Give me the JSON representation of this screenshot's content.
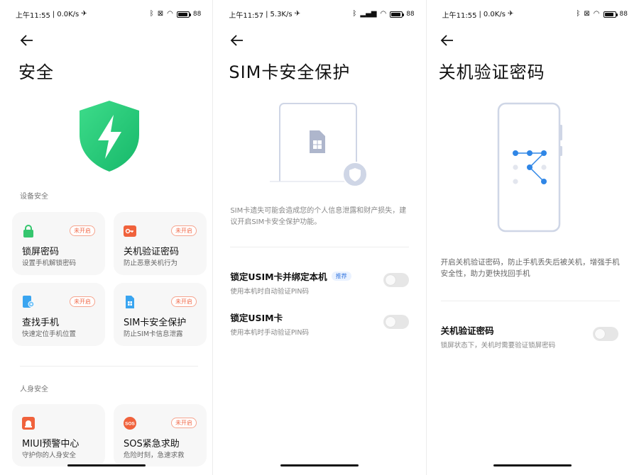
{
  "screens": [
    {
      "status": {
        "time": "上午11:55",
        "speed": "0.0K/s",
        "battery": "88"
      },
      "title": "安全",
      "sections": [
        {
          "label": "设备安全"
        },
        {
          "label": "人身安全"
        }
      ],
      "cards": [
        {
          "title": "锁屏密码",
          "subtitle": "设置手机解锁密码",
          "badge": "未开启",
          "icon": "lock-icon"
        },
        {
          "title": "关机验证密码",
          "subtitle": "防止恶意关机行为",
          "badge": "未开启",
          "icon": "key-icon"
        },
        {
          "title": "查找手机",
          "subtitle": "快速定位手机位置",
          "badge": "未开启",
          "icon": "find-phone-icon"
        },
        {
          "title": "SIM卡安全保护",
          "subtitle": "防止SIM卡信息泄露",
          "badge": "未开启",
          "icon": "sim-card-icon"
        },
        {
          "title": "MIUI预警中心",
          "subtitle": "守护你的人身安全",
          "badge": "",
          "icon": "alert-icon"
        },
        {
          "title": "SOS紧急求助",
          "subtitle": "危险时刻，急速求救",
          "badge": "未开启",
          "icon": "sos-icon"
        }
      ]
    },
    {
      "status": {
        "time": "上午11:57",
        "speed": "5.3K/s",
        "battery": "88"
      },
      "title": "SIM卡安全保护",
      "description": "SIM卡遗失可能会造成您的个人信息泄露和财产损失，建议开启SIM卡安全保护功能。",
      "rows": [
        {
          "title": "锁定USIM卡并绑定本机",
          "tag": "推荐",
          "subtitle": "使用本机时自动验证PIN码",
          "enabled": false
        },
        {
          "title": "锁定USIM卡",
          "subtitle": "使用本机时手动验证PIN码",
          "enabled": false
        }
      ]
    },
    {
      "status": {
        "time": "上午11:55",
        "speed": "0.0K/s",
        "battery": "88"
      },
      "title": "关机验证密码",
      "description": "开启关机验证密码，防止手机丢失后被关机，增强手机安全性，助力更快找回手机",
      "rows": [
        {
          "title": "关机验证密码",
          "subtitle": "锁屏状态下，关机时需要验证锁屏密码",
          "enabled": false
        }
      ]
    }
  ],
  "colors": {
    "accent_green": "#2ecc71",
    "badge_red": "#f06a4a",
    "tag_blue": "#3a7be0"
  }
}
